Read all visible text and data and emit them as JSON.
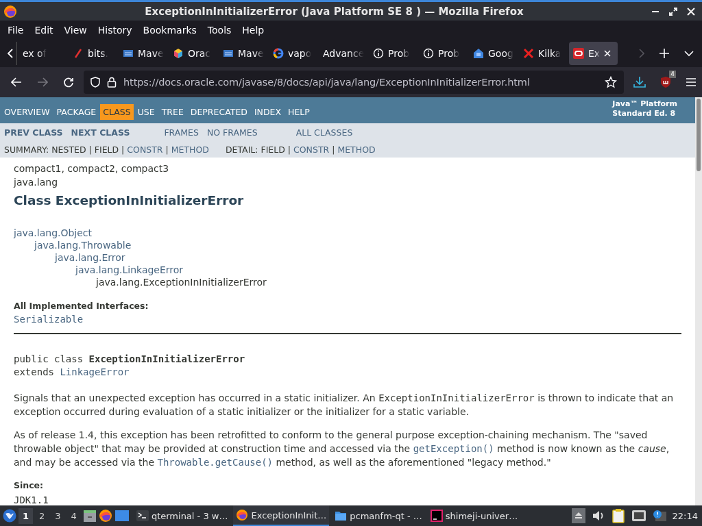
{
  "window": {
    "title": "ExceptionInInitializerError (Java Platform SE 8 ) — Mozilla Firefox"
  },
  "menu": [
    "File",
    "Edit",
    "View",
    "History",
    "Bookmarks",
    "Tools",
    "Help"
  ],
  "tabs": [
    {
      "label": "ex of",
      "kind": "plain",
      "selected": false
    },
    {
      "label": "bits.",
      "kind": "pencil",
      "selected": false
    },
    {
      "label": "Mave",
      "kind": "grid",
      "selected": false
    },
    {
      "label": "Orac",
      "kind": "cube",
      "selected": false
    },
    {
      "label": "Mave",
      "kind": "grid",
      "selected": false
    },
    {
      "label": "vapo",
      "kind": "google",
      "selected": false
    },
    {
      "label": "Advance",
      "kind": "plain",
      "selected": false
    },
    {
      "label": "Prob",
      "kind": "info",
      "selected": false
    },
    {
      "label": "Prob",
      "kind": "info",
      "selected": false
    },
    {
      "label": "Goog",
      "kind": "house",
      "selected": false
    },
    {
      "label": "Kilka",
      "kind": "cross",
      "selected": false
    },
    {
      "label": "Ex",
      "kind": "oracle",
      "selected": true
    }
  ],
  "address": {
    "url": "https://docs.oracle.com/javase/8/docs/api/java/lang/ExceptionInInitializerError.html"
  },
  "extension_badge": "4",
  "top_nav": {
    "items": [
      {
        "label": "OVERVIEW",
        "selected": false
      },
      {
        "label": "PACKAGE",
        "selected": false
      },
      {
        "label": "CLASS",
        "selected": true
      },
      {
        "label": "USE",
        "selected": false
      },
      {
        "label": "TREE",
        "selected": false
      },
      {
        "label": "DEPRECATED",
        "selected": false
      },
      {
        "label": "INDEX",
        "selected": false
      },
      {
        "label": "HELP",
        "selected": false
      }
    ],
    "platform_label": [
      "Java™ Platform",
      "Standard Ed. 8"
    ]
  },
  "sub_nav": {
    "class_links": [
      "PREV CLASS",
      "NEXT CLASS"
    ],
    "frame_links": [
      "FRAMES",
      "NO FRAMES"
    ],
    "all_classes": "ALL CLASSES",
    "summary": [
      {
        "text": "SUMMARY: NESTED | FIELD |",
        "kind": "plain"
      },
      {
        "text": "CONSTR",
        "kind": "link"
      },
      {
        "text": "|",
        "kind": "plain"
      },
      {
        "text": "METHOD",
        "kind": "link"
      }
    ],
    "detail": [
      {
        "text": "DETAIL: FIELD |",
        "kind": "plain"
      },
      {
        "text": "CONSTR",
        "kind": "link"
      },
      {
        "text": "|",
        "kind": "plain"
      },
      {
        "text": "METHOD",
        "kind": "link"
      }
    ]
  },
  "content": {
    "profiles": "compact1, compact2, compact3",
    "package": "java.lang",
    "heading": "Class ExceptionInInitializerError",
    "inheritance": [
      {
        "name": "java.lang.Object",
        "link": true,
        "children": [
          {
            "name": "java.lang.Throwable",
            "link": true,
            "children": [
              {
                "name": "java.lang.Error",
                "link": true,
                "children": [
                  {
                    "name": "java.lang.LinkageError",
                    "link": true,
                    "children": [
                      {
                        "name": "java.lang.ExceptionInInitializerError",
                        "link": false
                      }
                    ]
                  }
                ]
              }
            ]
          }
        ]
      }
    ],
    "interfaces_label": "All Implemented Interfaces:",
    "interfaces": [
      "Serializable"
    ],
    "signature": "public class **ExceptionInInitializerError**",
    "extends_keyword": "extends",
    "extends_class": "LinkageError",
    "paragraphs": [
      [
        {
          "kind": "text",
          "text": "Signals that an unexpected exception has occurred in a static initializer. An "
        },
        {
          "kind": "code",
          "text": "ExceptionInInitializerError"
        },
        {
          "kind": "text",
          "text": " is thrown to indicate that an exception occurred during evaluation of a static initializer or the initializer for a static variable."
        }
      ],
      [
        {
          "kind": "text",
          "text": "As of release 1.4, this exception has been retrofitted to conform to the general purpose exception-chaining mechanism. The \"saved throwable object\" that may be provided at construction time and accessed via the "
        },
        {
          "kind": "link",
          "text": "getException()"
        },
        {
          "kind": "text",
          "text": " method is now known as the "
        },
        {
          "kind": "italic",
          "text": "cause"
        },
        {
          "kind": "text",
          "text": ", and may be accessed via the "
        },
        {
          "kind": "link",
          "text": "Throwable.getCause()"
        },
        {
          "kind": "text",
          "text": " method, as well as the aforementioned \"legacy method.\""
        }
      ]
    ],
    "since_label": "Since:",
    "since": "JDK1.1"
  },
  "taskbar": {
    "workspaces": [
      {
        "label": "1",
        "selected": true
      },
      {
        "label": "2",
        "selected": false
      },
      {
        "label": "3",
        "selected": false
      },
      {
        "label": "4",
        "selected": false
      }
    ],
    "tasks": [
      {
        "label": "qterminal - 3 w…",
        "kind": "terminal",
        "selected": false
      },
      {
        "label": "ExceptionInInit…",
        "kind": "firefox",
        "selected": true
      },
      {
        "label": "pcmanfm-qt - …",
        "kind": "folder",
        "selected": false
      },
      {
        "label": "shimeji-univer…",
        "kind": "ide",
        "selected": false
      }
    ],
    "clock": "22:14"
  }
}
